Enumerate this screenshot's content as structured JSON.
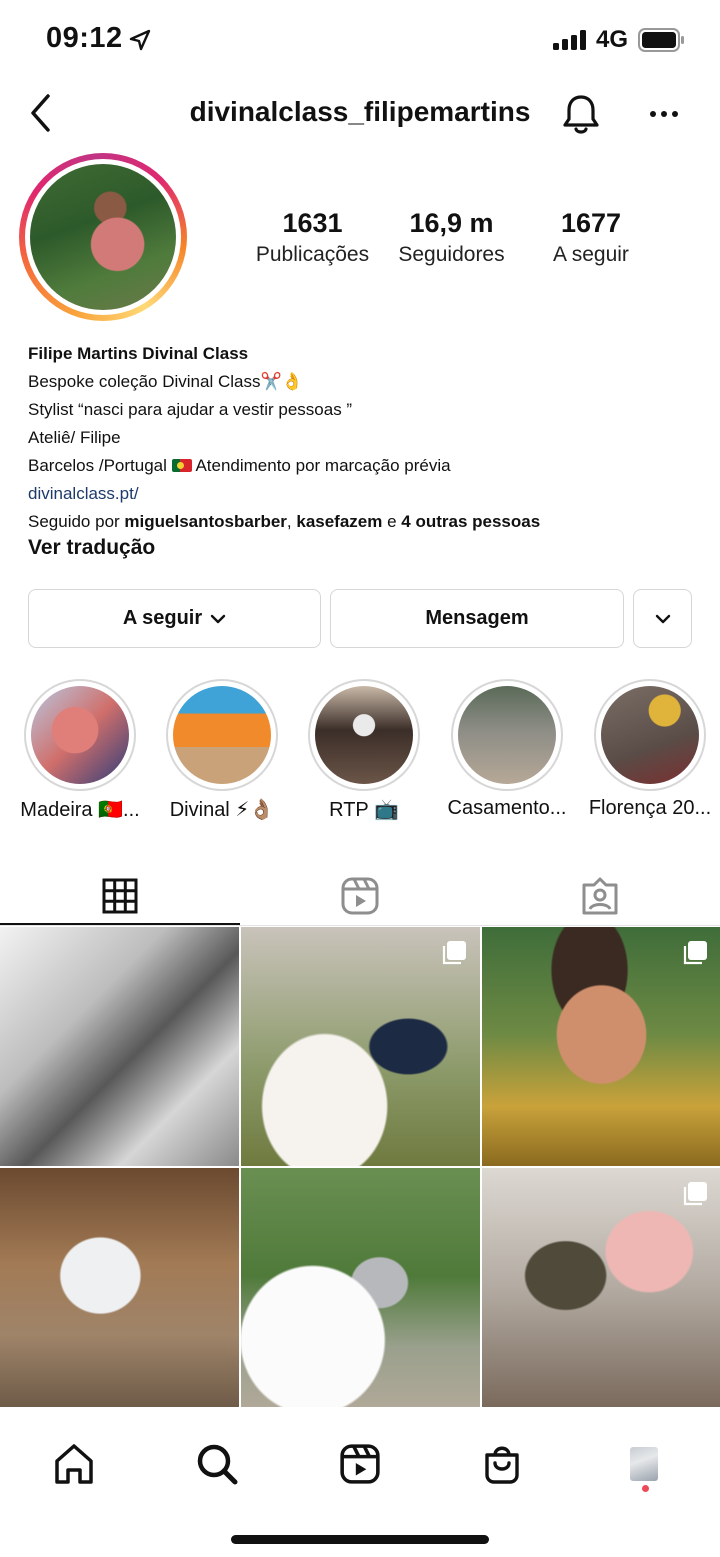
{
  "status_bar": {
    "time": "09:12",
    "network": "4G"
  },
  "header": {
    "username": "divinalclass_filipemartins"
  },
  "stats": [
    {
      "value": "1631",
      "label": "Publicações"
    },
    {
      "value": "16,9 m",
      "label": "Seguidores"
    },
    {
      "value": "1677",
      "label": "A seguir"
    }
  ],
  "bio": {
    "name": "Filipe Martins Divinal Class",
    "line1": "Bespoke coleção Divinal Class✂️👌",
    "line2": "Stylist “nasci para ajudar a vestir pessoas ”",
    "line3": "Ateliê/ Filipe",
    "line4a": "Barcelos /Portugal",
    "line4b": "Atendimento por marcação prévia",
    "link": "divinalclass.pt/",
    "followed_prefix": "Seguido por ",
    "followed_user1": "miguelsantosbarber",
    "followed_sep": ", ",
    "followed_user2": "kasefazem",
    "followed_and": " e ",
    "followed_others": "4 outras pessoas",
    "translate": "Ver tradução"
  },
  "buttons": {
    "following": "A seguir",
    "message": "Mensagem"
  },
  "highlights": [
    {
      "label": "Madeira 🇵🇹..."
    },
    {
      "label": "Divinal ⚡👌🏽"
    },
    {
      "label": "RTP 📺"
    },
    {
      "label": "Casamento..."
    },
    {
      "label": "Florença 20..."
    }
  ],
  "tabs": {
    "active": "grid"
  },
  "colors": {
    "accent_link": "#1e3a6b",
    "notification_dot": "#ed4956"
  },
  "icons": [
    "location-arrow-icon",
    "signal-icon",
    "battery-icon",
    "back-icon",
    "bell-icon",
    "more-icon",
    "grid-icon",
    "reels-icon",
    "tagged-icon",
    "home-icon",
    "search-icon",
    "reels-nav-icon",
    "shop-icon"
  ]
}
